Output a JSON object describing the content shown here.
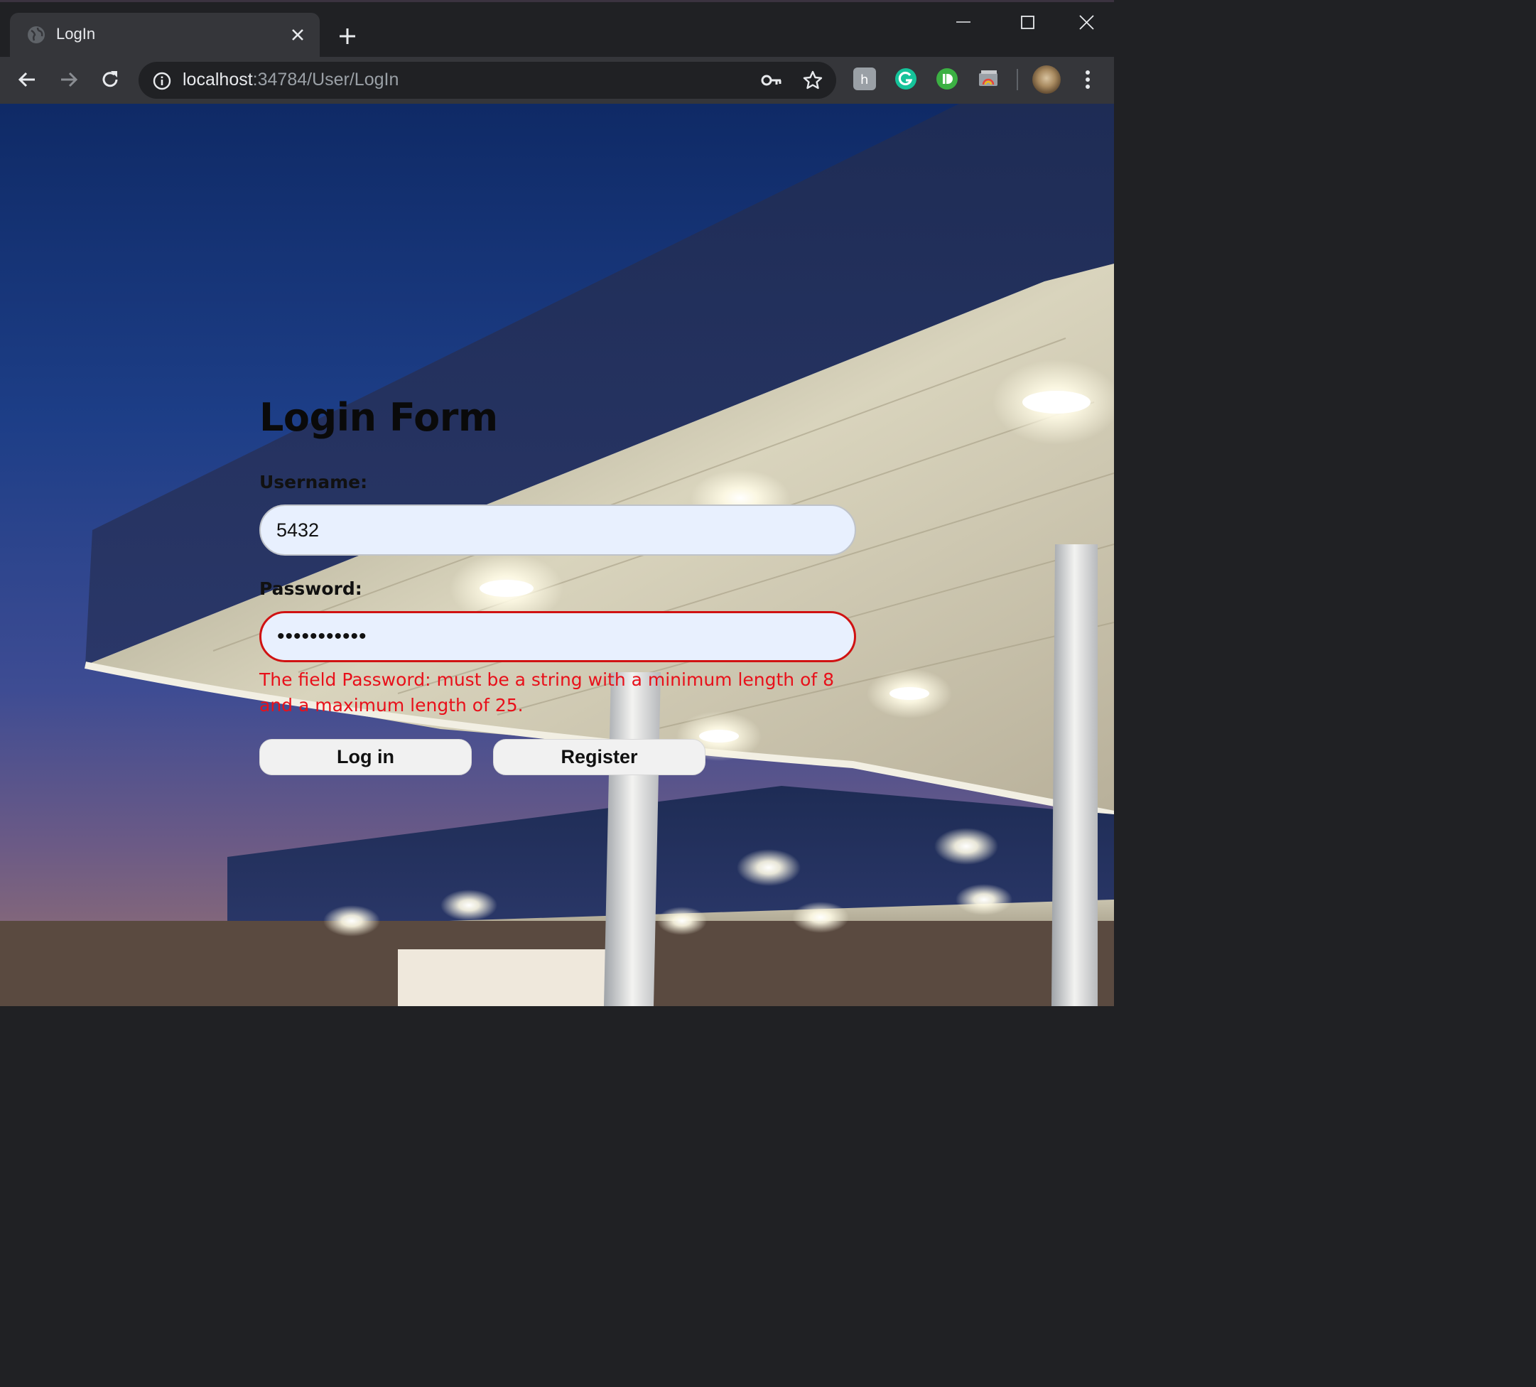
{
  "browser": {
    "tab": {
      "title": "LogIn"
    },
    "address_bar": {
      "host": "localhost",
      "path": ":34784/User/LogIn"
    },
    "colors": {
      "frame": "#202124",
      "toolbar": "#35363a"
    }
  },
  "page": {
    "background_photo": "gas-station-canopy-at-dusk",
    "form": {
      "title": "Login Form",
      "username": {
        "label": "Username:",
        "value": "5432"
      },
      "password": {
        "label": "Password:",
        "masked_value": "•••••••••••",
        "state": "invalid"
      },
      "validation_error": "The field Password: must be a string with a minimum length of 8 and a maximum length of 25.",
      "buttons": {
        "login": "Log in",
        "register": "Register"
      }
    },
    "colors": {
      "error": "#e8101a",
      "input_fill": "#e8f0fe",
      "invalid_border": "#d01212"
    }
  }
}
